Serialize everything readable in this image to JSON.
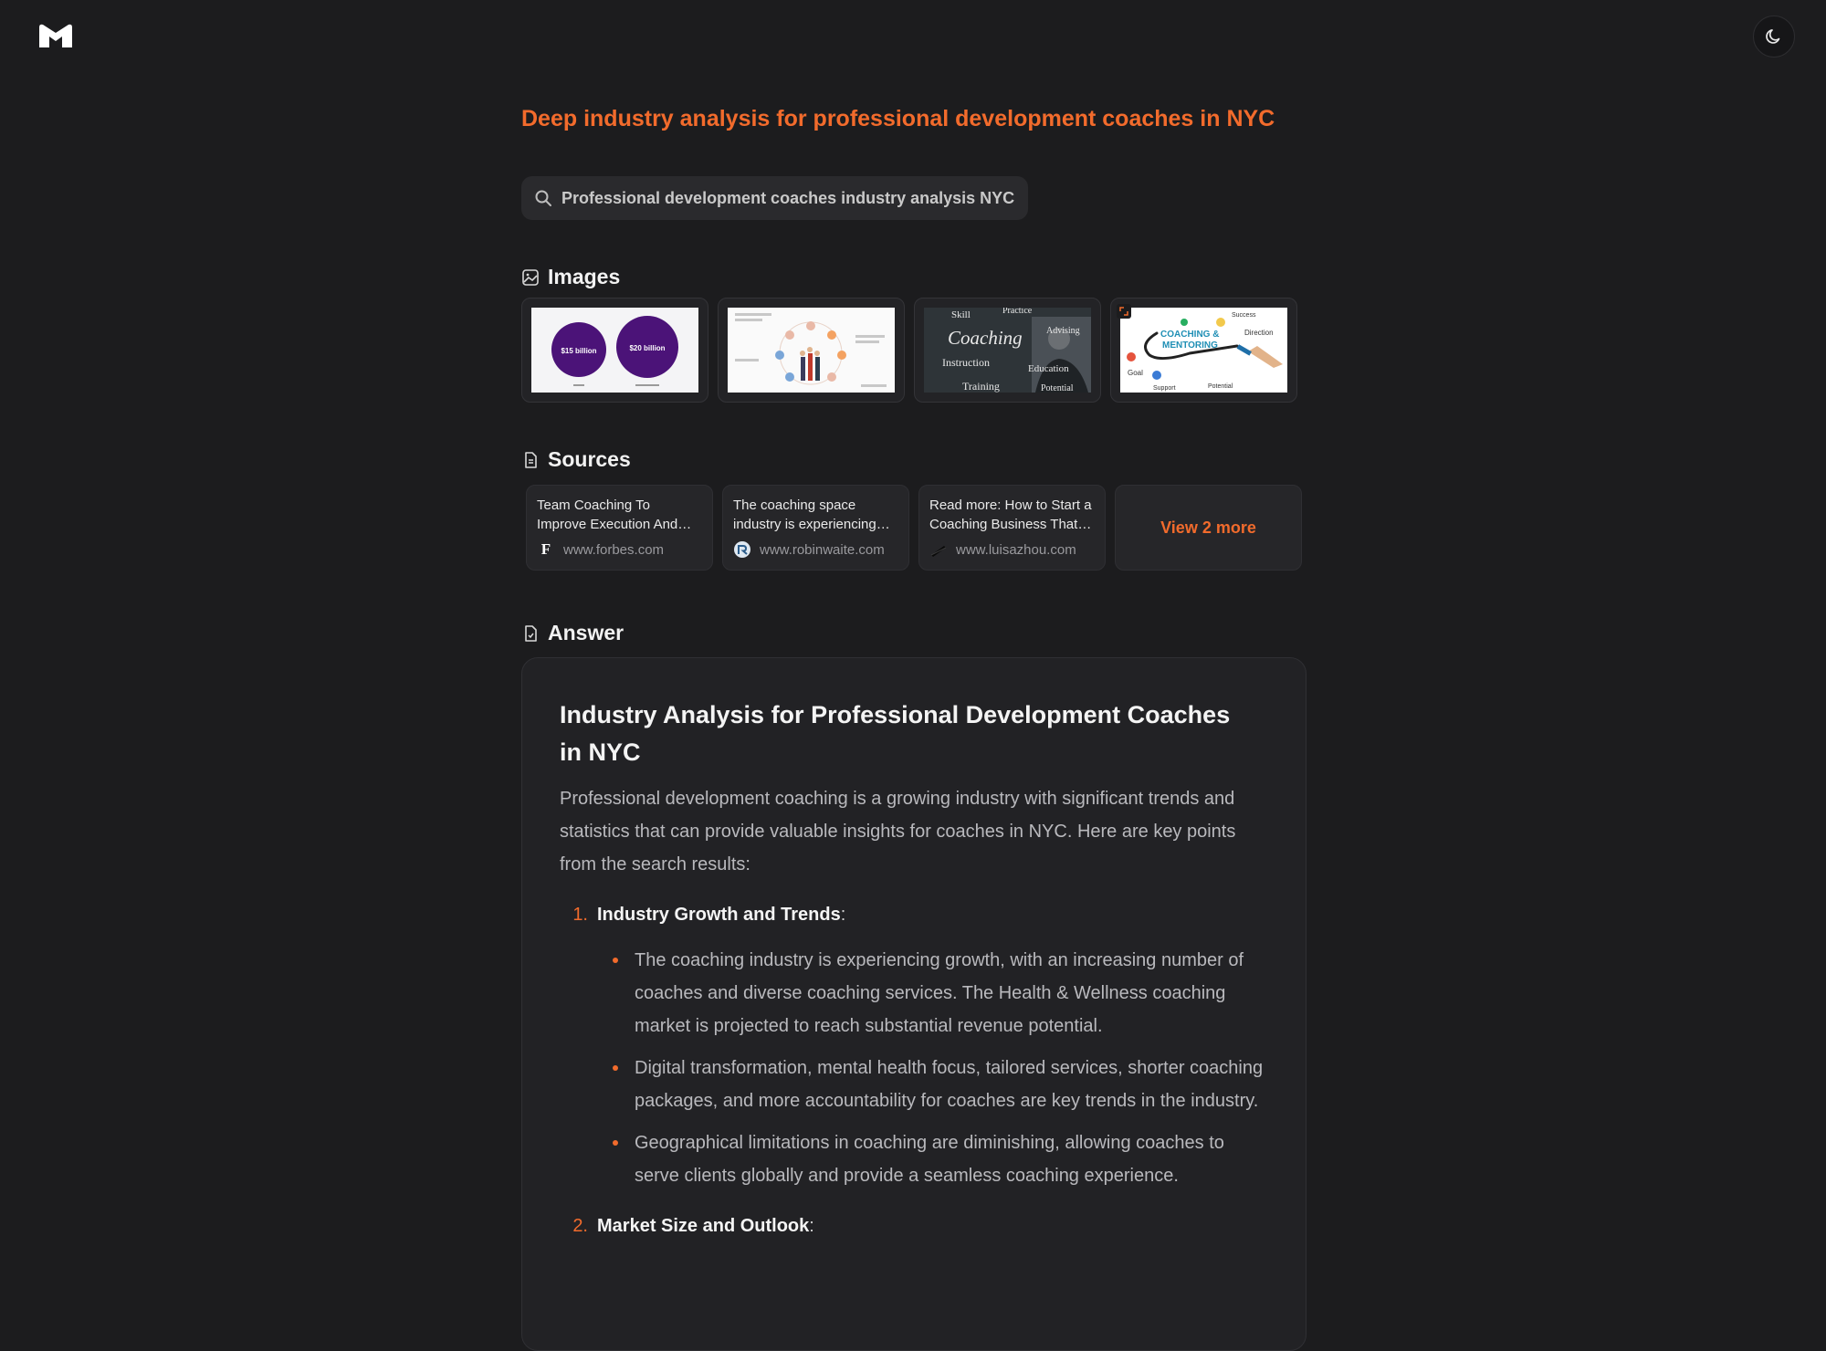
{
  "app": {
    "logo_name": "M logo"
  },
  "query": {
    "title": "Deep industry analysis for professional development coaches in NYC",
    "search_text": "Professional development coaches industry analysis NYC"
  },
  "sections": {
    "images": "Images",
    "sources": "Sources",
    "answer": "Answer"
  },
  "images": [
    {
      "id": "market-size-chart",
      "labels": [
        "$15 billion",
        "$20 billion"
      ]
    },
    {
      "id": "coaching-infographic"
    },
    {
      "id": "coaching-chalkboard",
      "labels": [
        "Skill",
        "Practice",
        "Coaching",
        "Advising",
        "Instruction",
        "Education",
        "Training",
        "Potential"
      ]
    },
    {
      "id": "coaching-mentoring-sketch",
      "labels": [
        "COACHING &",
        "MENTORING",
        "Direction",
        "Goal",
        "Support",
        "Potential",
        "Success"
      ]
    }
  ],
  "sources": [
    {
      "title": "Team Coaching To Improve Execution And Results",
      "domain": "www.forbes.com",
      "favicon": "F"
    },
    {
      "title": "The coaching space industry is experiencing growth",
      "domain": "www.robinwaite.com",
      "favicon": "robinwaite-icon"
    },
    {
      "title": "Read more: How to Start a Coaching Business That Works",
      "domain": "www.luisazhou.com",
      "favicon": "luisazhou-icon"
    }
  ],
  "sources_more": "View 2 more",
  "answer": {
    "heading": "Industry Analysis for Professional Development Coaches in NYC",
    "intro": "Professional development coaching is a growing industry with significant trends and statistics that can provide valuable insights for coaches in NYC. Here are key points from the search results:",
    "items": [
      {
        "num": "1.",
        "title": "Industry Growth and Trends",
        "colon": ":",
        "bullets": [
          "The coaching industry is experiencing growth, with an increasing number of coaches and diverse coaching services. The Health & Wellness coaching market is projected to reach substantial revenue potential.",
          "Digital transformation, mental health focus, tailored services, shorter coaching packages, and more accountability for coaches are key trends in the industry.",
          "Geographical limitations in coaching are diminishing, allowing coaches to serve clients globally and provide a seamless coaching experience."
        ]
      },
      {
        "num": "2.",
        "title": "Market Size and Outlook",
        "colon": ":"
      }
    ]
  },
  "colors": {
    "accent": "#f26b2c",
    "background": "#1c1c1e",
    "card": "#222225"
  }
}
